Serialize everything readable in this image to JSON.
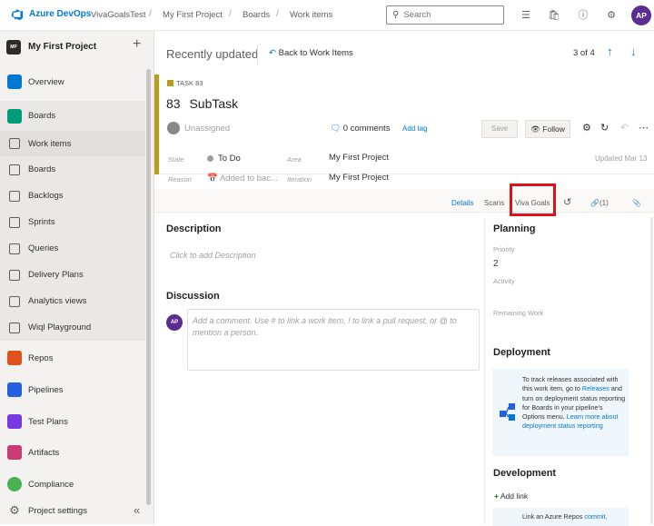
{
  "topbar": {
    "brand": "Azure DevOps",
    "breadcrumbs": [
      "VivaGoalsTest",
      "My First Project",
      "Boards",
      "Work items"
    ],
    "search_placeholder": "Search",
    "user_initials": "AP"
  },
  "sidebar": {
    "project_initials": "MP",
    "project_name": "My First Project",
    "items": [
      {
        "label": "Overview",
        "icon": "overview-icon",
        "color": "#0078d4"
      },
      {
        "label": "Boards",
        "icon": "boards-icon",
        "color": "#009c7a"
      },
      {
        "label": "Work items",
        "icon": "work-items-icon"
      },
      {
        "label": "Boards",
        "icon": "board-sub-icon"
      },
      {
        "label": "Backlogs",
        "icon": "backlogs-icon"
      },
      {
        "label": "Sprints",
        "icon": "sprints-icon"
      },
      {
        "label": "Queries",
        "icon": "queries-icon"
      },
      {
        "label": "Delivery Plans",
        "icon": "delivery-plans-icon"
      },
      {
        "label": "Analytics views",
        "icon": "analytics-icon"
      },
      {
        "label": "Wiql Playground",
        "icon": "wiql-icon"
      },
      {
        "label": "Repos",
        "icon": "repos-icon",
        "color": "#e0521b"
      },
      {
        "label": "Pipelines",
        "icon": "pipelines-icon",
        "color": "#2560e0"
      },
      {
        "label": "Test Plans",
        "icon": "test-plans-icon",
        "color": "#773adc"
      },
      {
        "label": "Artifacts",
        "icon": "artifacts-icon",
        "color": "#c83b74"
      },
      {
        "label": "Compliance",
        "icon": "compliance-icon",
        "color": "#4caf50"
      },
      {
        "label": "Project settings",
        "icon": "gear-icon"
      }
    ]
  },
  "main": {
    "recently_updated": "Recently updated",
    "back_link": "Back to Work Items",
    "pager": "3 of 4",
    "work_item": {
      "type_label": "TASK 83",
      "id": "83",
      "title": "SubTask",
      "assigned": "Unassigned",
      "comments": "0 comments",
      "add_tag": "Add tag",
      "save": "Save",
      "follow": "Follow",
      "state_label": "State",
      "state_value": "To Do",
      "reason_label": "Reason",
      "reason_value": "Added to bac...",
      "area_label": "Area",
      "area_value": "My First Project",
      "iteration_label": "Iteration",
      "iteration_value": "My First Project",
      "updated": "Updated Mar 13"
    },
    "tabs": [
      "Details",
      "Scans",
      "Viva Goals",
      "(1)"
    ],
    "description": {
      "title": "Description",
      "placeholder": "Click to add Description"
    },
    "discussion": {
      "title": "Discussion",
      "avatar": "AP",
      "placeholder": "Add a comment. Use # to link a work item, ! to link a pull request, or @ to mention a person."
    },
    "planning": {
      "title": "Planning",
      "priority_label": "Priority",
      "priority_value": "2",
      "activity_label": "Activity",
      "remaining_label": "Remaining Work"
    },
    "deployment": {
      "title": "Deployment",
      "text_1": "To track releases associated with this work item, go to",
      "link_1": "Releases",
      "text_2": "and turn on deployment status reporting for Boards in your pipeline's Options menu.",
      "link_2": "Learn more about deployment status reporting"
    },
    "development": {
      "title": "Development",
      "add_link": "Add link",
      "text": "Link an Azure Repos",
      "link": "commit,"
    }
  }
}
